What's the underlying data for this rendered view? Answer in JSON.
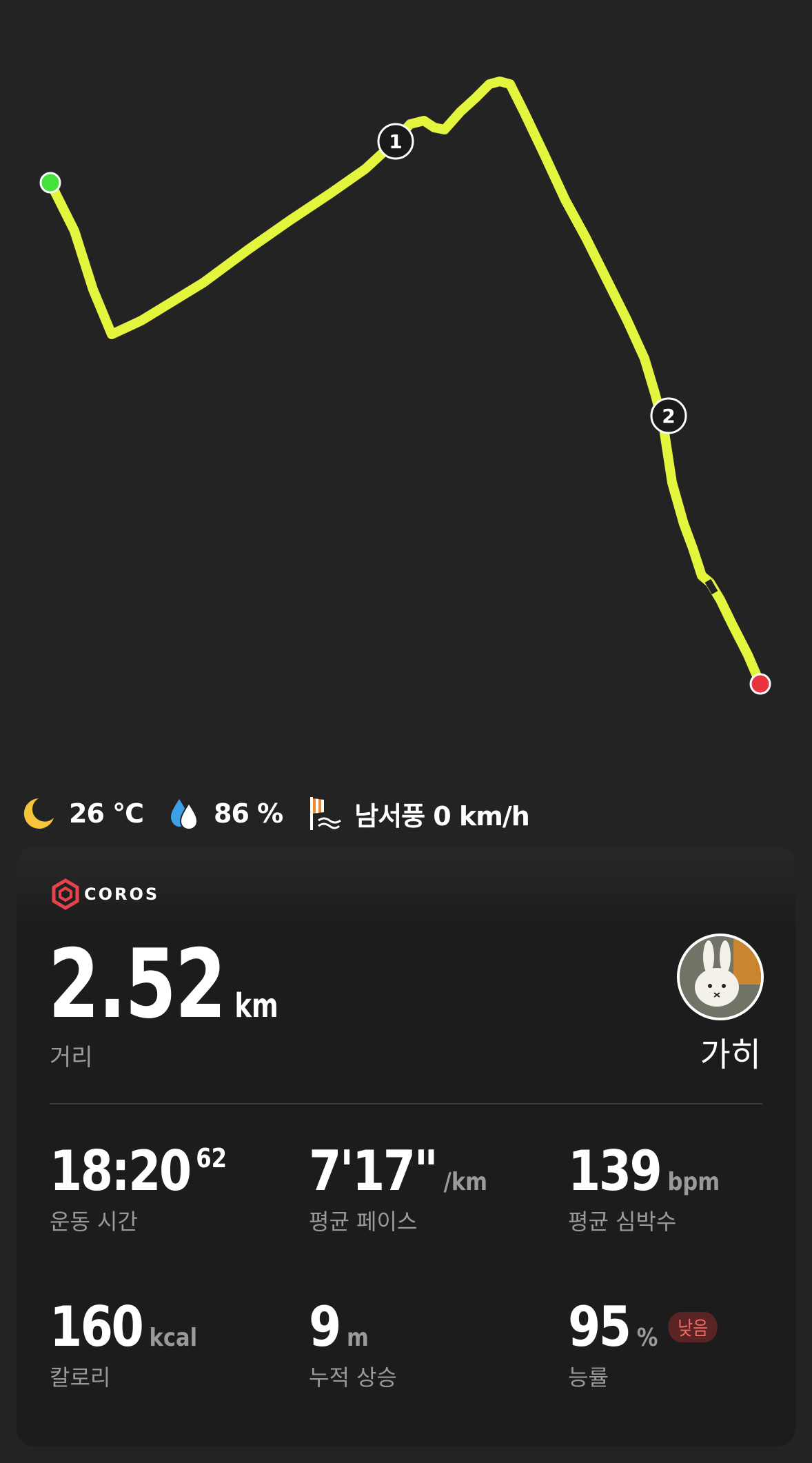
{
  "route": {
    "laps": [
      "1",
      "2"
    ],
    "start_color": "#44e13a",
    "end_color": "#e8343e",
    "line_color": "#e4f53d"
  },
  "weather": {
    "moon_icon": "moon-icon",
    "temperature": "26 °C",
    "humidity": "86 %",
    "wind": "남서풍 0 km/h"
  },
  "brand": {
    "logo_text": "COROS",
    "logo_color": "#e8424a"
  },
  "summary": {
    "distance_value": "2.52",
    "distance_unit": "km",
    "distance_label": "거리",
    "user_name": "가히"
  },
  "stats": [
    {
      "value": "18:20",
      "sup": "62",
      "unit": "",
      "label": "운동 시간"
    },
    {
      "value": "7'17\"",
      "sup": "",
      "unit": "/km",
      "label": "평균 페이스"
    },
    {
      "value": "139",
      "sup": "",
      "unit": "bpm",
      "label": "평균 심박수"
    },
    {
      "value": "160",
      "sup": "",
      "unit": "kcal",
      "label": "칼로리"
    },
    {
      "value": "9",
      "sup": "",
      "unit": "m",
      "label": "누적 상승"
    },
    {
      "value": "95",
      "sup": "",
      "unit": "%",
      "label": "능률",
      "badge": "낮음"
    }
  ]
}
